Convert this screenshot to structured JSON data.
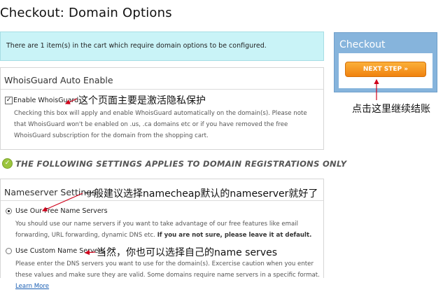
{
  "page": {
    "title": "Checkout: Domain Options"
  },
  "cart_notice": {
    "text": "There are 1 item(s) in the cart which require domain options to be configured."
  },
  "whoisguard": {
    "title": "WhoisGuard Auto Enable",
    "checkbox_label": "Enable WhoisGuard",
    "checked": true,
    "description": "Checking this box will apply and enable WhoisGuard automatically on the domain(s). Please note that WhoisGuard won't be enabled on .us, .ca domains etc or if you have removed the free WhoisGuard subscription for the domain from the shopping cart."
  },
  "section_heading": {
    "text": "THE FOLLOWING SETTINGS APPLIES TO DOMAIN REGISTRATIONS ONLY",
    "icon": "check-circle-icon"
  },
  "nameserver": {
    "title": "Nameserver Settings",
    "options": [
      {
        "label": "Use Our Free Name Servers",
        "selected": true,
        "description_plain": "You should use our name servers if you want to take advantage of our free features like email forwarding, URL forwarding, dynamic DNS etc. ",
        "description_bold": "If you are not sure, please leave it at default."
      },
      {
        "label": "Use Custom Name Servers",
        "selected": false,
        "description_plain": "Please enter the DNS servers you want to use for the domain(s). Excercise caution when you enter these values and make sure they are valid. Some domains require name servers in a specific format. ",
        "link_text": "Learn More"
      }
    ]
  },
  "checkout_panel": {
    "title": "Checkout",
    "button_label": "NEXT STEP »"
  },
  "annotations": {
    "whoisguard_note": "这个页面主要是激活隐私保护",
    "next_step_note": "点击这里继续结账",
    "free_ns_note": "一般建议选择namecheap默认的nameserver就好了",
    "custom_ns_note": "当然，你也可以选择自己的name serves"
  },
  "colors": {
    "annotation_arrow": "#d0021b",
    "next_button": "#f39a1f",
    "checkout_panel": "#86b4dc",
    "notice_bg": "#c9f3f7"
  }
}
